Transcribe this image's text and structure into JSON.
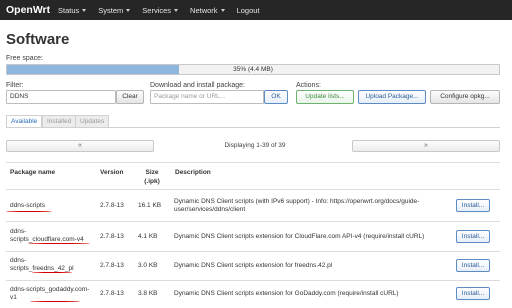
{
  "nav": {
    "brand": "OpenWrt",
    "items": [
      {
        "label": "Status",
        "has_caret": true
      },
      {
        "label": "System",
        "has_caret": true
      },
      {
        "label": "Services",
        "has_caret": true
      },
      {
        "label": "Network",
        "has_caret": true
      },
      {
        "label": "Logout",
        "has_caret": false
      }
    ]
  },
  "page": {
    "title": "Software",
    "free_space_label": "Free space:",
    "free_space_text": "35% (4.4 MB)",
    "free_space_fraction": 0.35
  },
  "filter": {
    "label": "Filter:",
    "value": "DDNS",
    "clear": "Clear"
  },
  "download": {
    "label": "Download and install package:",
    "placeholder": "Package name or URL...",
    "ok": "OK"
  },
  "actions": {
    "label": "Actions:",
    "update": "Update lists...",
    "upload": "Upload Package...",
    "configure": "Configure opkg..."
  },
  "tabs": [
    {
      "label": "Available",
      "active": true
    },
    {
      "label": "Installed",
      "active": false
    },
    {
      "label": "Updates",
      "active": false
    }
  ],
  "pager": {
    "prev": "«",
    "next": "»",
    "text": "Displaying 1-39 of 39"
  },
  "table": {
    "headers": {
      "name": "Package name",
      "version": "Version",
      "size": "Size (.ipk)",
      "description": "Description"
    },
    "rows": [
      {
        "name": "ddns-scripts",
        "version": "2.7.8-13",
        "size": "16.1 KB",
        "desc": "Dynamic DNS Client scripts (with IPv6 support) - Info: https://openwrt.org/docs/guide-user/services/ddns/client",
        "action": "Install..."
      },
      {
        "name": "ddns-scripts_cloudflare.com-v4",
        "version": "2.7.8-13",
        "size": "4.1 KB",
        "desc": "Dynamic DNS Client scripts extension for CloudFlare.com API-v4 (require/install cURL)",
        "action": "Install..."
      },
      {
        "name": "ddns-scripts_freedns_42_pl",
        "version": "2.7.8-13",
        "size": "3.0 KB",
        "desc": "Dynamic DNS Client scripts extension for freedns.42.pl",
        "action": "Install..."
      },
      {
        "name": "ddns-scripts_godaddy.com-v1",
        "version": "2.7.8-13",
        "size": "3.8 KB",
        "desc": "Dynamic DNS Client scripts extension for GoDaddy.com (require/install cURL)",
        "action": "Install..."
      }
    ]
  },
  "annotation_color": "#d40000",
  "accent_color": "#2a6ab8"
}
